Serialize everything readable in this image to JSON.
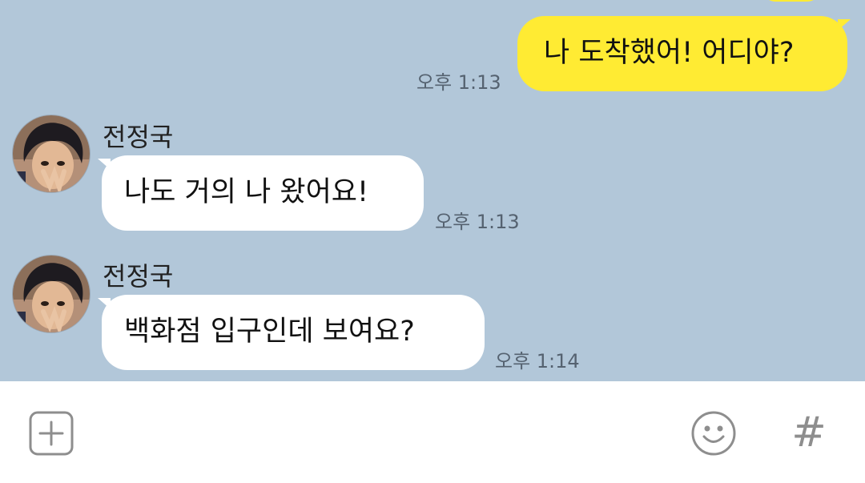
{
  "messages": [
    {
      "sender": "me",
      "text": "나 도착했어! 어디야?",
      "time": "오후 1:13"
    },
    {
      "sender": "전정국",
      "avatar_icon": "user-avatar",
      "text": "나도 거의 나 왔어요!",
      "time": "오후 1:13"
    },
    {
      "sender": "전정국",
      "avatar_icon": "user-avatar",
      "text": "백화점 입구인데 보여요?",
      "time": "오후 1:14"
    }
  ],
  "input_bar": {
    "attach_icon": "plus-box-icon",
    "emoji_icon": "smiley-icon",
    "hashtag_icon": "hashtag-icon",
    "hashtag_glyph": "#"
  },
  "colors": {
    "chat_background": "#b2c7d9",
    "my_bubble": "#ffeb33",
    "their_bubble": "#ffffff",
    "timestamp": "#556270",
    "icon_gray": "#8e8e8e"
  }
}
